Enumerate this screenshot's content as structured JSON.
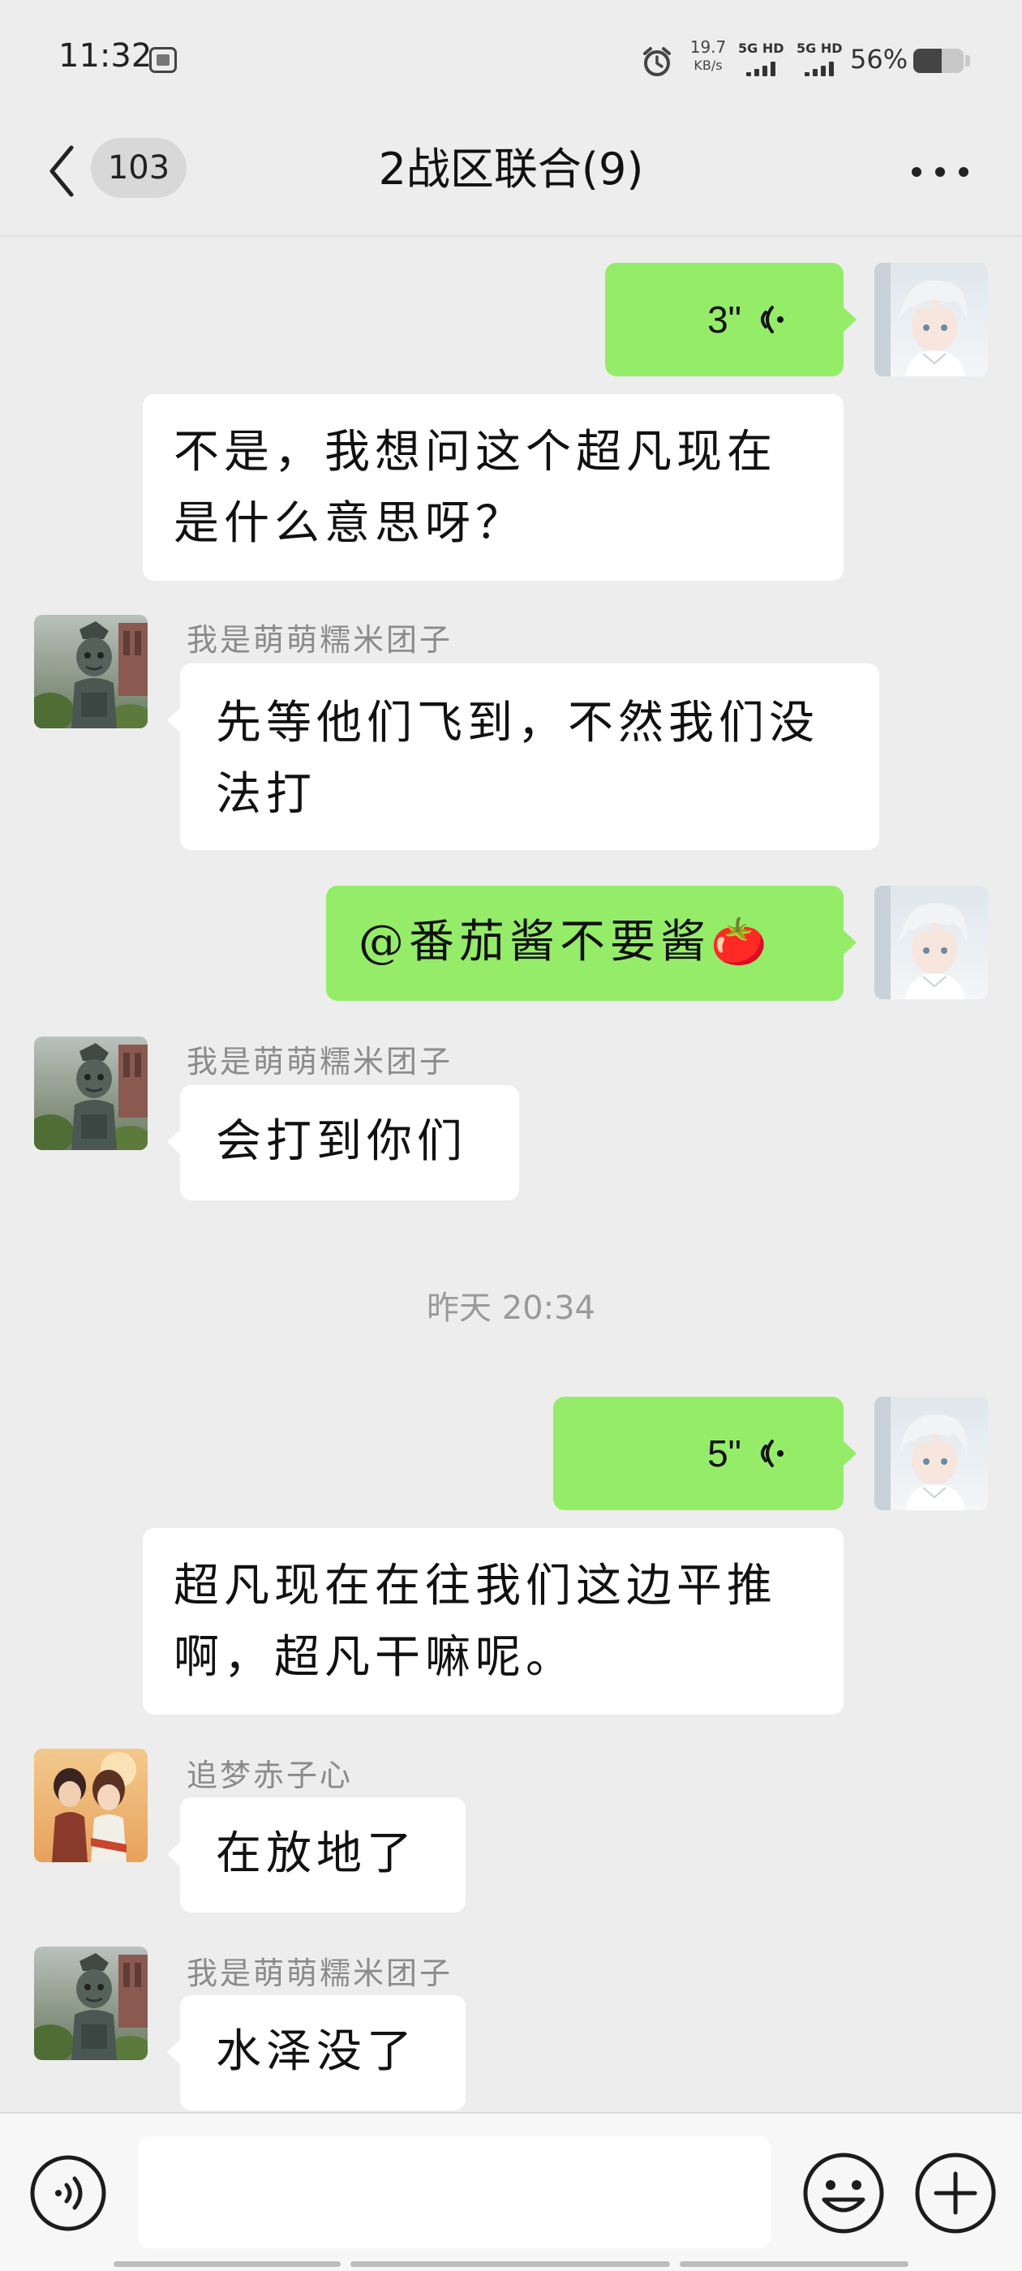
{
  "status_bar": {
    "time": "11:32",
    "net_speed_value": "19.7",
    "net_speed_unit": "KB/s",
    "signal_1": "5G HD",
    "signal_2": "5G HD",
    "battery": "56%",
    "battery_level": 0.56,
    "icons": [
      "sim-app-icon",
      "alarm-icon",
      "signal-icon",
      "signal-icon",
      "battery-icon"
    ]
  },
  "header": {
    "unread_count": "103",
    "title": "2战区联合(9)",
    "icons": [
      "back-arrow-icon",
      "more-icon"
    ]
  },
  "messages": [
    {
      "id": "m1",
      "direction": "outgoing",
      "type": "voice",
      "duration": "3\""
    },
    {
      "id": "m2",
      "direction": "outgoing",
      "type": "text",
      "lines": [
        "不是，我想问这个超凡现在",
        "是什么意思呀？"
      ]
    },
    {
      "id": "m3",
      "direction": "incoming",
      "sender": "我是萌萌糯米团子",
      "type": "text",
      "lines": [
        "先等他们飞到，不然我们没",
        "法打"
      ]
    },
    {
      "id": "m4",
      "direction": "outgoing",
      "type": "text",
      "lines": [
        "@番茄酱不要酱🍅"
      ]
    },
    {
      "id": "m5",
      "direction": "incoming",
      "sender": "我是萌萌糯米团子",
      "type": "text",
      "lines": [
        "会打到你们"
      ]
    },
    {
      "id": "t1",
      "type": "timestamp",
      "text": "昨天 20:34"
    },
    {
      "id": "m6",
      "direction": "outgoing",
      "type": "voice",
      "duration": "5\""
    },
    {
      "id": "m7",
      "direction": "outgoing",
      "type": "text",
      "lines": [
        "超凡现在在往我们这边平推",
        "啊，超凡干嘛呢。"
      ]
    },
    {
      "id": "m8",
      "direction": "incoming",
      "sender": "追梦赤子心",
      "type": "text",
      "lines": [
        "在放地了"
      ]
    },
    {
      "id": "m9",
      "direction": "incoming",
      "sender": "我是萌萌糯米团子",
      "type": "text",
      "lines": [
        "水泽没了"
      ]
    }
  ],
  "input_bar": {
    "value": "",
    "icons": [
      "voice-toggle-icon",
      "emoji-icon",
      "plus-icon"
    ]
  },
  "colors": {
    "background": "#ededed",
    "outgoing_bubble": "#95ec69",
    "incoming_bubble": "#ffffff",
    "sender_name": "#8b8b8b"
  }
}
